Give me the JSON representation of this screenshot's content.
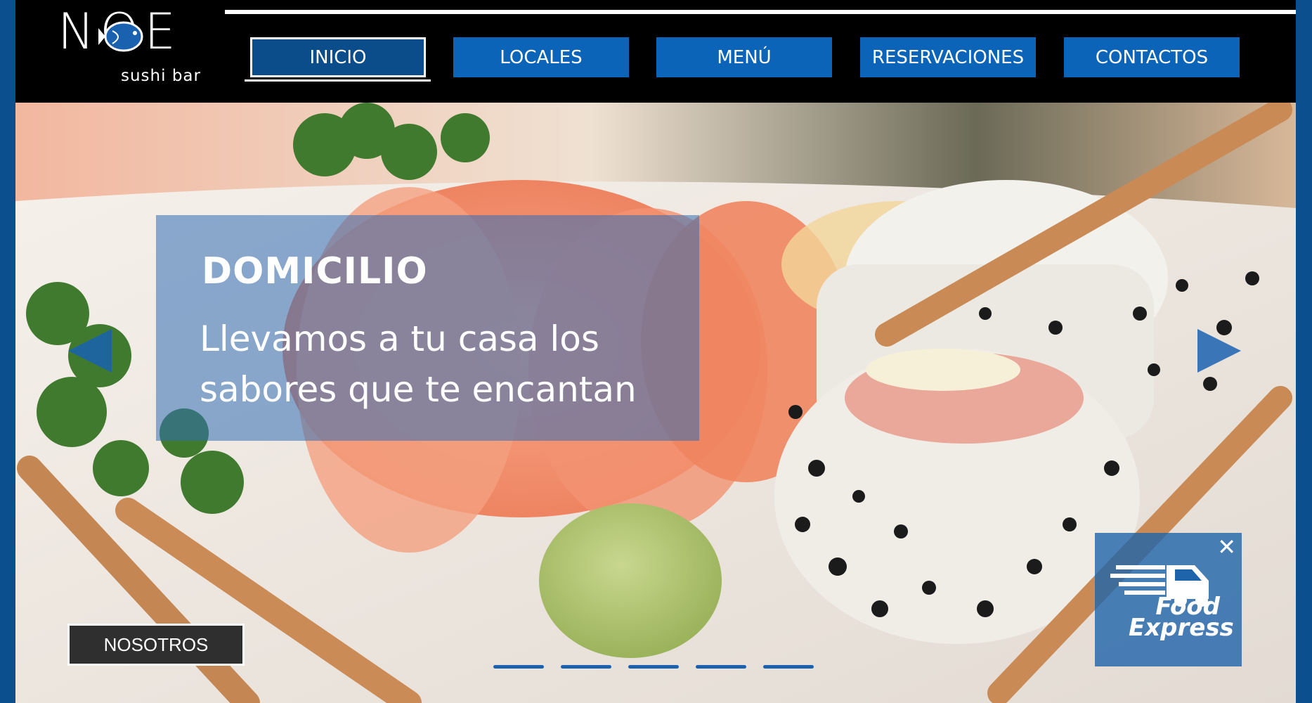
{
  "logo": {
    "name": "NOE",
    "tagline": "sushi bar"
  },
  "nav": [
    {
      "label": "INICIO",
      "active": true
    },
    {
      "label": "LOCALES"
    },
    {
      "label": "MENÚ"
    },
    {
      "label": "RESERVACIONES"
    },
    {
      "label": "CONTACTOS"
    }
  ],
  "slide": {
    "title": "DOMICILIO",
    "text": "Llevamos a tu casa los sabores que te encantan"
  },
  "buttons": {
    "nosotros": "NOSOTROS"
  },
  "carousel": {
    "slide_count": 5,
    "active_index": 0
  },
  "promo": {
    "line1": "Food",
    "line2": "Express",
    "close_glyph": "✕"
  },
  "colors": {
    "accent": "#0b64b8",
    "nav_active": "#0b4c8a",
    "frame": "#0c4f8f"
  }
}
